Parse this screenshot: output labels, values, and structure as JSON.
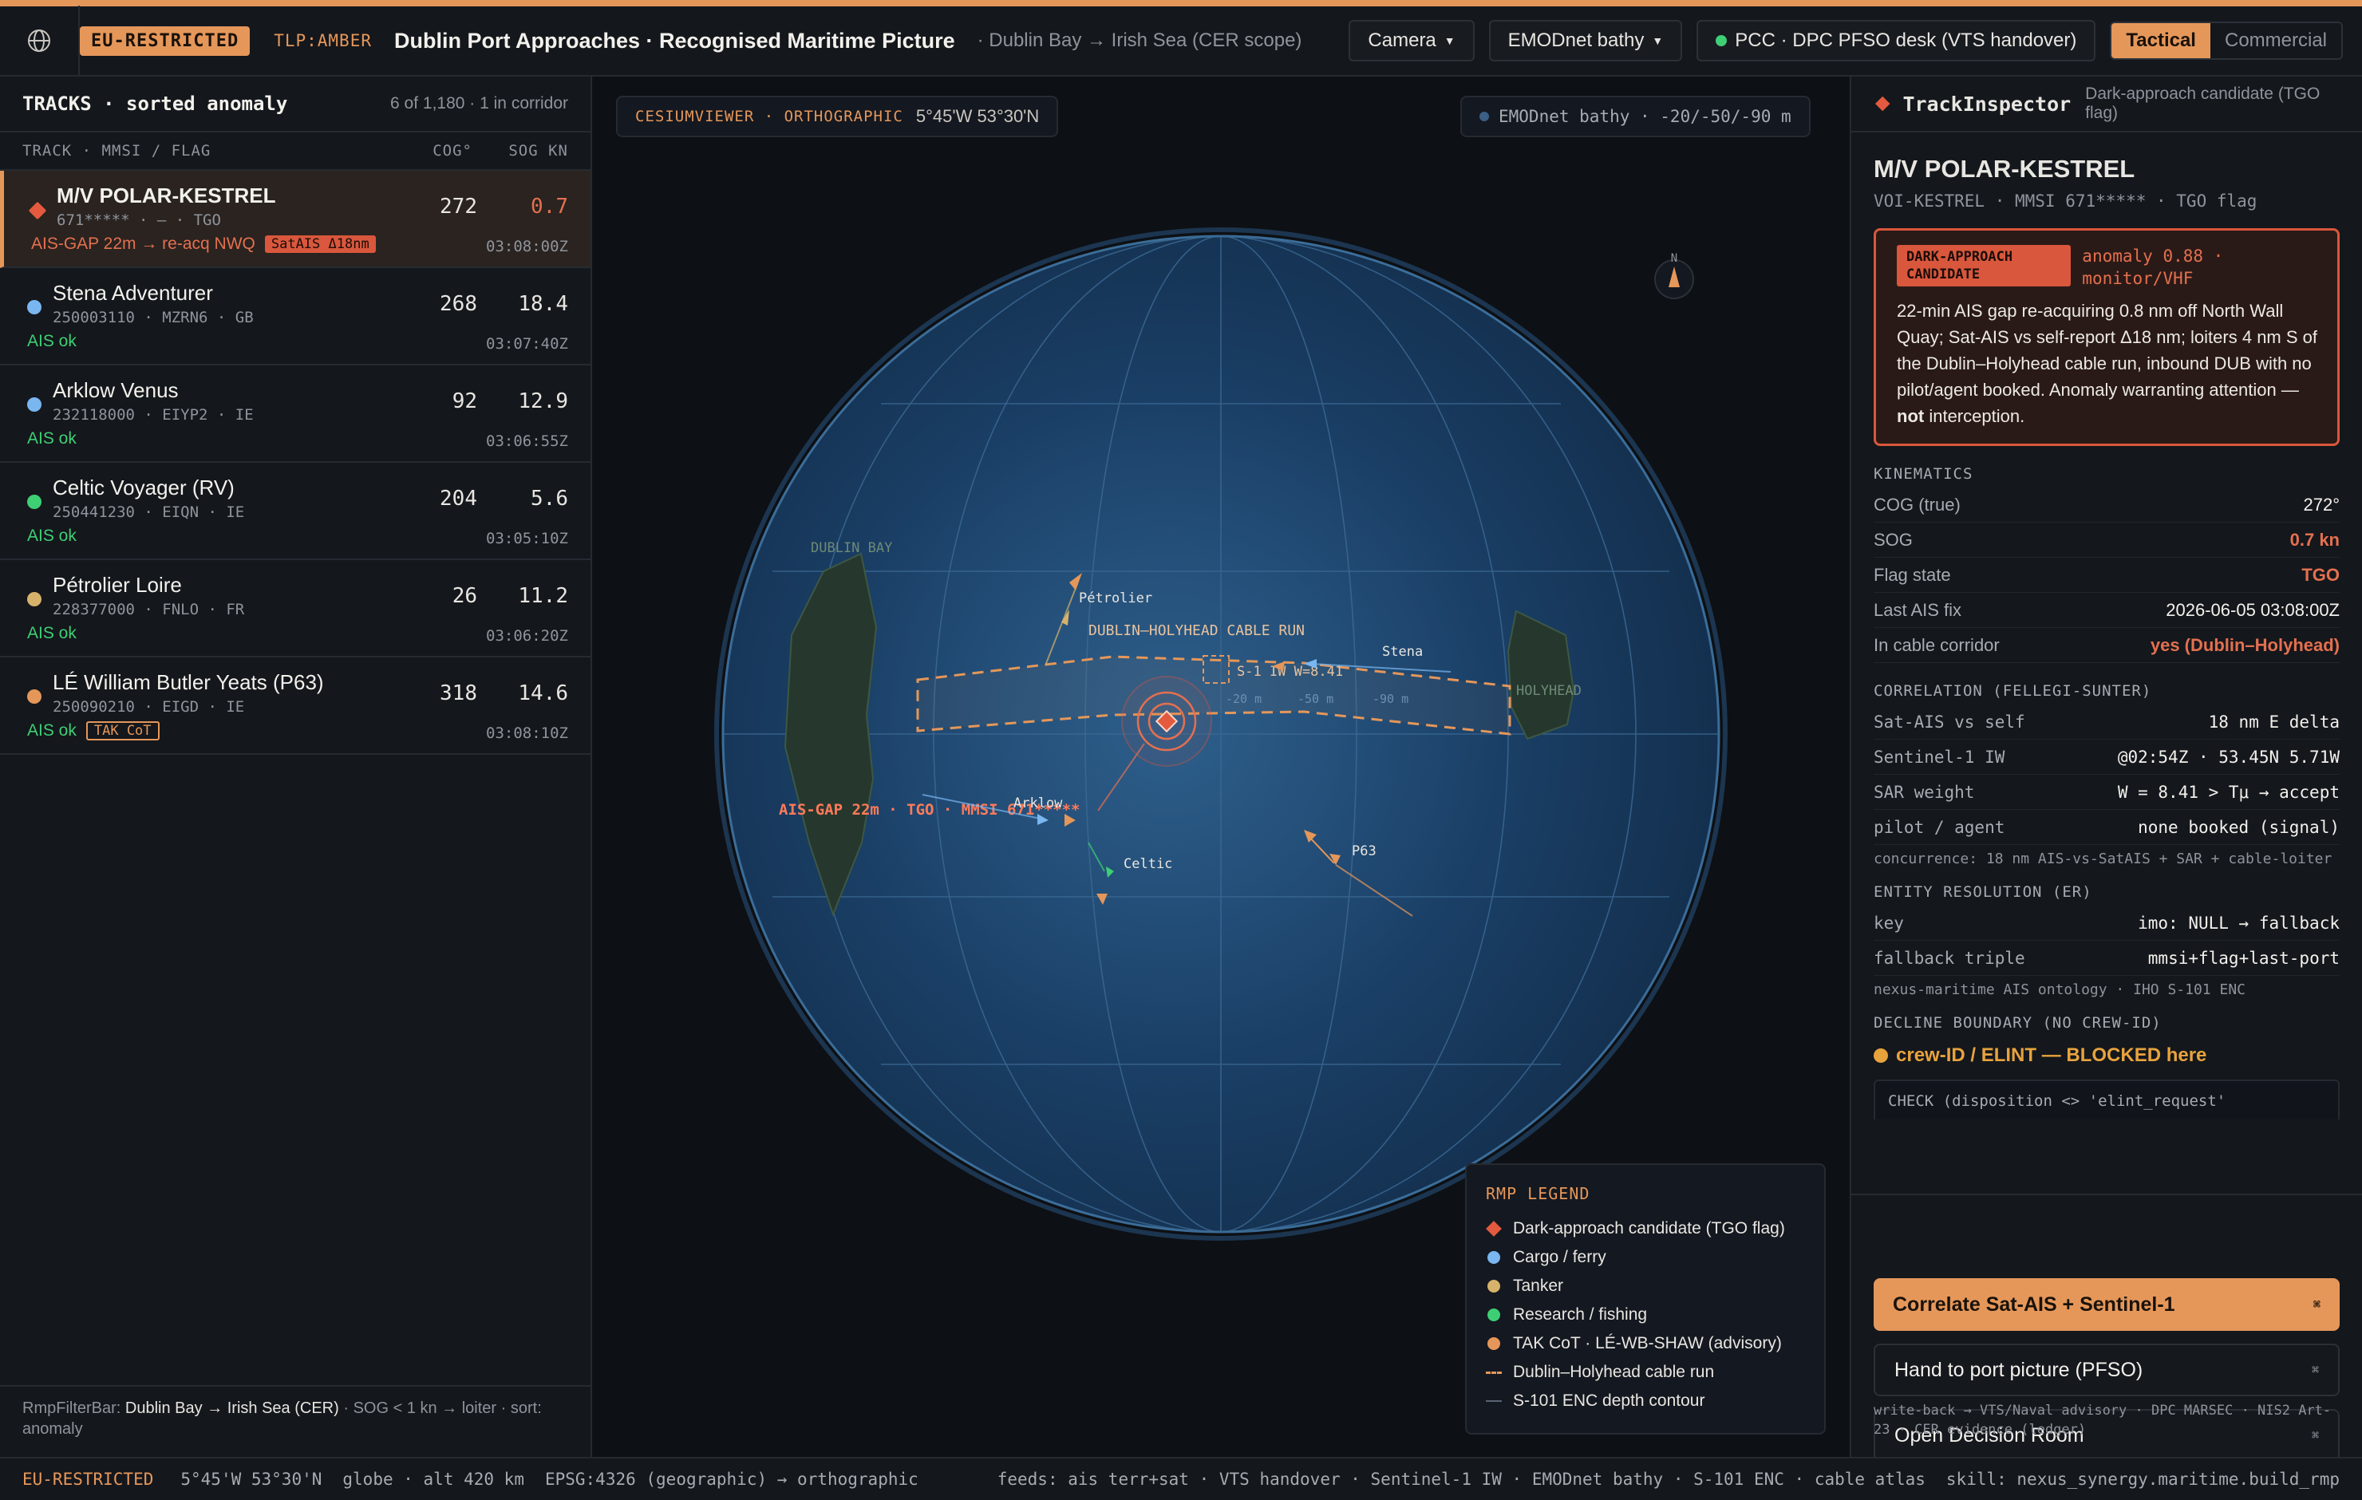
{
  "topbar": {
    "classification": "EU-RESTRICTED",
    "tlp": "TLP:AMBER",
    "title": "Dublin Port Approaches · Recognised Maritime Picture",
    "subtitle": "· Dublin Bay → Irish Sea (CER scope)",
    "camera_label": "Camera",
    "bathy_label": "EMODnet bathy",
    "pcc_label": "PCC · DPC PFSO desk (VTS handover)",
    "mode_tactical": "Tactical",
    "mode_commercial": "Commercial",
    "accent": "#e5975a",
    "status_green": "#3ecf74"
  },
  "tracks": {
    "title": "TRACKS · sorted anomaly",
    "count": "6 of 1,180 · 1 in corridor",
    "col_track": "TRACK · MMSI / FLAG",
    "col_cog": "COG°",
    "col_sog": "SOG KN",
    "items": [
      {
        "name": "M/V POLAR-KESTREL",
        "meta": "671***** · — · TGO",
        "cog": "272",
        "sog": "0.7",
        "status": "AIS-GAP 22m → re-acq NWQ",
        "tag": "SatAIS Δ18nm",
        "time": "03:08:00Z",
        "color": "#e45a3e",
        "icon": "diamond-icon"
      },
      {
        "name": "Stena Adventurer",
        "meta": "250003110 · MZRN6 · GB",
        "cog": "268",
        "sog": "18.4",
        "status": "AIS ok",
        "time": "03:07:40Z",
        "color": "#7ab6f0",
        "icon": "cargo-dot-icon"
      },
      {
        "name": "Arklow Venus",
        "meta": "232118000 · EIYP2 · IE",
        "cog": "92",
        "sog": "12.9",
        "status": "AIS ok",
        "time": "03:06:55Z",
        "color": "#7ab6f0",
        "icon": "cargo-dot-icon"
      },
      {
        "name": "Celtic Voyager (RV)",
        "meta": "250441230 · EIQN · IE",
        "cog": "204",
        "sog": "5.6",
        "status": "AIS ok",
        "time": "03:05:10Z",
        "color": "#3ecf74",
        "icon": "research-dot-icon"
      },
      {
        "name": "Pétrolier Loire",
        "meta": "228377000 · FNLO · FR",
        "cog": "26",
        "sog": "11.2",
        "status": "AIS ok",
        "time": "03:06:20Z",
        "color": "#d6b26a",
        "icon": "tanker-dot-icon"
      },
      {
        "name": "LÉ William Butler Yeats (P63)",
        "meta": "250090210 · EIGD · IE",
        "cog": "318",
        "sog": "14.6",
        "status": "AIS ok",
        "tag": "TAK CoT",
        "time": "03:08:10Z",
        "color": "#e5975a",
        "icon": "tak-dot-icon"
      }
    ],
    "filter_prefix": "RmpFilterBar:",
    "filter_scope": "Dublin Bay → Irish Sea (CER)",
    "filter_rest": "· SOG < 1 kn → loiter · sort: anomaly"
  },
  "map": {
    "viewer_label": "CESIUMVIEWER · ORTHOGRAPHIC",
    "coords": "5°45'W 53°30'N",
    "bathy_chip": "EMODnet bathy · -20/-50/-90 m",
    "north": "N",
    "dublin_bay": "DUBLIN BAY",
    "holyhead": "HOLYHEAD",
    "cable_label": "DUBLIN–HOLYHEAD CABLE RUN",
    "s1_label": "S-1 IW W=8.41",
    "depth_20": "-20 m",
    "depth_50": "-50 m",
    "depth_90": "-90 m",
    "gap_label": "AIS-GAP 22m · TGO · MMSI 671*****",
    "lbl_petrolier": "Pétrolier",
    "lbl_stena": "Stena",
    "lbl_arklow": "Arklow",
    "lbl_celtic": "Celtic",
    "lbl_p63": "P63"
  },
  "legend": {
    "title": "RMP LEGEND",
    "items": [
      {
        "label": "Dark-approach candidate (TGO flag)",
        "color": "#e45a3e",
        "icon": "diamond-icon"
      },
      {
        "label": "Cargo / ferry",
        "color": "#7ab6f0",
        "icon": "dot-icon"
      },
      {
        "label": "Tanker",
        "color": "#d6b26a",
        "icon": "dot-icon"
      },
      {
        "label": "Research / fishing",
        "color": "#3ecf74",
        "icon": "dot-icon"
      },
      {
        "label": "TAK CoT · LÉ-WB-SHAW (advisory)",
        "color": "#e5975a",
        "icon": "dot-icon"
      },
      {
        "label": "Dublin–Holyhead cable run",
        "color": "#e5975a",
        "icon": "dashed-line-icon"
      },
      {
        "label": "S-101 ENC depth contour",
        "color": "#5a6472",
        "icon": "line-icon"
      }
    ]
  },
  "inspector": {
    "title": "TrackInspector",
    "subtitle": "Dark-approach candidate (TGO flag)",
    "vessel": "M/V POLAR-KESTREL",
    "vmeta": "VOI-KESTREL · MMSI 671***** · TGO flag",
    "alert_tag": "DARK-APPROACH CANDIDATE",
    "alert_score": "anomaly 0.88 · monitor/VHF",
    "alert_body": "22-min AIS gap re-acquiring 0.8 nm off North Wall Quay; Sat-AIS vs self-report Δ18 nm; loiters 4 nm S of the Dublin–Holyhead cable run, inbound DUB with no pilot/agent booked. Anomaly warranting attention —",
    "alert_not": "not",
    "alert_end": "interception.",
    "kin_title": "KINEMATICS",
    "kin": [
      {
        "k": "COG (true)",
        "v": "272°"
      },
      {
        "k": "SOG",
        "v": "0.7 kn"
      },
      {
        "k": "Flag state",
        "v": "TGO"
      },
      {
        "k": "Last AIS fix",
        "v": "2026-06-05 03:08:00Z"
      },
      {
        "k": "In cable corridor",
        "v": "yes (Dublin–Holyhead)"
      }
    ],
    "corr_title": "CORRELATION (FELLEGI-SUNTER)",
    "corr": [
      {
        "k": "Sat-AIS vs self",
        "v": "18 nm E delta"
      },
      {
        "k": "Sentinel-1 IW",
        "v": "@02:54Z · 53.45N 5.71W"
      },
      {
        "k": "SAR weight",
        "v": "W = 8.41 > Tμ → accept"
      },
      {
        "k": "pilot / agent",
        "v": "none booked (signal)"
      }
    ],
    "corr_note": "concurrence: 18 nm AIS-vs-SatAIS + SAR + cable-loiter",
    "er_title": "ENTITY RESOLUTION (ER)",
    "er": [
      {
        "k": "key",
        "v": "imo: NULL → fallback"
      },
      {
        "k": "fallback triple",
        "v": "mmsi+flag+last-port"
      }
    ],
    "er_note": "nexus-maritime AIS ontology · IHO S-101 ENC",
    "decline_title": "DECLINE BOUNDARY (NO CREW-ID)",
    "blocked": "crew-ID / ELINT — BLOCKED here",
    "check": "CHECK (disposition <> 'elint_request'",
    "btn_correlate": "Correlate Sat-AIS + Sentinel-1",
    "btn_hand": "Hand to port picture (PFSO)",
    "btn_room": "Open Decision Room",
    "kbd": "⌘",
    "writeback": "write-back → VTS/Naval advisory · DPC MARSEC · NIS2 Art-23 · CER evidence (ledger)"
  },
  "statusbar": {
    "classification": "EU-RESTRICTED",
    "coords": "5°45'W 53°30'N",
    "view": "globe · alt 420 km",
    "proj": "EPSG:4326 (geographic) → orthographic",
    "feeds": "feeds: ais terr+sat · VTS handover · Sentinel-1 IW · EMODnet bathy · S-101 ENC · cable atlas",
    "skill": "skill: nexus_synergy.maritime.build_rmp"
  }
}
